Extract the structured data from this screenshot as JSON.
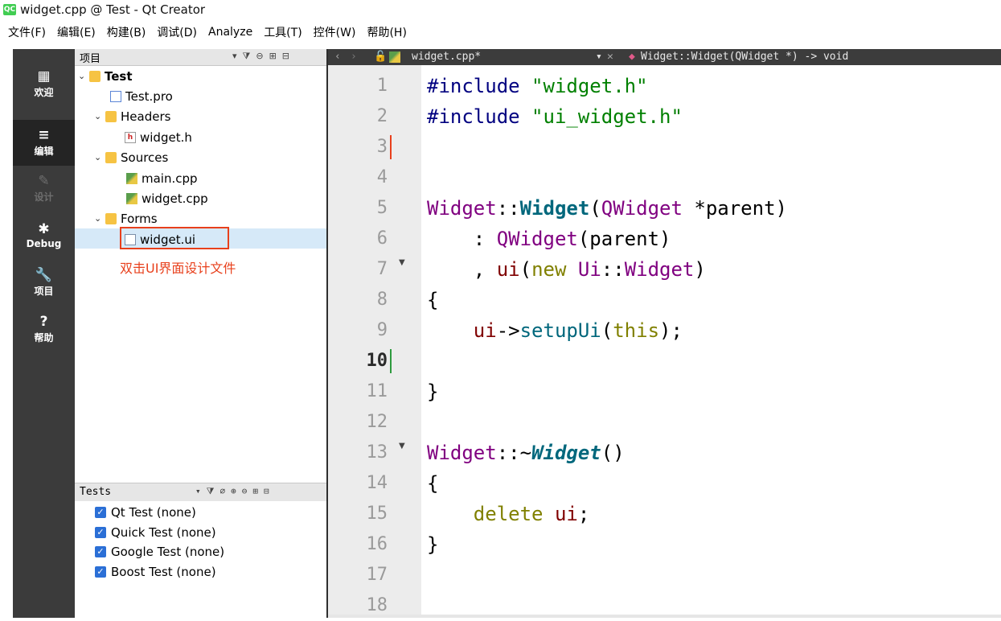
{
  "window": {
    "title": "widget.cpp @ Test - Qt Creator",
    "logo": "QC"
  },
  "menu": [
    "文件(F)",
    "编辑(E)",
    "构建(B)",
    "调试(D)",
    "Analyze",
    "工具(T)",
    "控件(W)",
    "帮助(H)"
  ],
  "modes": [
    {
      "label": "欢迎",
      "icon": "▦",
      "state": "normal"
    },
    {
      "label": "编辑",
      "icon": "≡",
      "state": "active"
    },
    {
      "label": "设计",
      "icon": "✎",
      "state": "disabled"
    },
    {
      "label": "Debug",
      "icon": "✱",
      "state": "normal"
    },
    {
      "label": "项目",
      "icon": "🔧",
      "state": "normal"
    },
    {
      "label": "帮助",
      "icon": "?",
      "state": "normal"
    }
  ],
  "project_pane": {
    "title": "项目",
    "tree": [
      {
        "label": "Test",
        "icon": "project-folder-icon",
        "expanded": true
      },
      {
        "label": "Test.pro",
        "icon": "pro-file-icon"
      },
      {
        "label": "Headers",
        "icon": "headers-folder-icon",
        "expanded": true
      },
      {
        "label": "widget.h",
        "icon": "header-file-icon"
      },
      {
        "label": "Sources",
        "icon": "sources-folder-icon",
        "expanded": true
      },
      {
        "label": "main.cpp",
        "icon": "cpp-file-icon"
      },
      {
        "label": "widget.cpp",
        "icon": "cpp-file-icon"
      },
      {
        "label": "Forms",
        "icon": "forms-folder-icon",
        "expanded": true
      },
      {
        "label": "widget.ui",
        "icon": "ui-file-icon",
        "selected": true
      }
    ],
    "annotation": "双击UI界面设计文件"
  },
  "tests_pane": {
    "title": "Tests",
    "items": [
      {
        "label": "Qt Test (none)",
        "checked": true
      },
      {
        "label": "Quick Test (none)",
        "checked": true
      },
      {
        "label": "Google Test (none)",
        "checked": true
      },
      {
        "label": "Boost Test (none)",
        "checked": true
      }
    ]
  },
  "editor": {
    "file_tab": "widget.cpp*",
    "symbol": "Widget::Widget(QWidget *) -> void",
    "current_line": 10,
    "line_numbers": [
      "1",
      "2",
      "3",
      "4",
      "5",
      "6",
      "7",
      "8",
      "9",
      "10",
      "11",
      "12",
      "13",
      "14",
      "15",
      "16",
      "17",
      "18"
    ]
  },
  "colors": {
    "accent_red": "#e8401c",
    "selection": "#d6e9f8",
    "modebar": "#3b3b3b"
  }
}
